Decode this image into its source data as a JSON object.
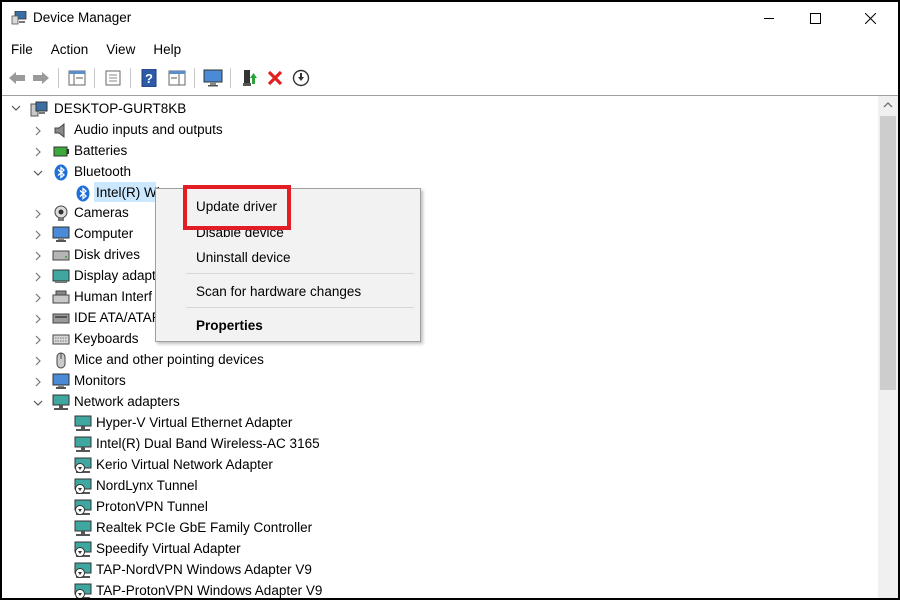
{
  "window": {
    "title": "Device Manager"
  },
  "menu": [
    "File",
    "Action",
    "View",
    "Help"
  ],
  "tree": {
    "root": "DESKTOP-GURT8KB",
    "categories": [
      "Audio inputs and outputs",
      "Batteries",
      "Bluetooth",
      "Intel(R) Wi",
      "Cameras",
      "Computer",
      "Disk drives",
      "Display adapt",
      "Human Interf",
      "IDE ATA/ATAPI",
      "Keyboards",
      "Mice and other pointing devices",
      "Monitors",
      "Network adapters"
    ],
    "network_adapters": [
      "Hyper-V Virtual Ethernet Adapter",
      "Intel(R) Dual Band Wireless-AC 3165",
      "Kerio Virtual Network Adapter",
      "NordLynx Tunnel",
      "ProtonVPN Tunnel",
      "Realtek PCIe GbE Family Controller",
      "Speedify Virtual Adapter",
      "TAP-NordVPN Windows Adapter V9",
      "TAP-ProtonVPN Windows Adapter V9"
    ]
  },
  "context_menu": {
    "update": "Update driver",
    "disable": "Disable device",
    "uninstall": "Uninstall device",
    "scan": "Scan for hardware changes",
    "properties": "Properties"
  },
  "colors": {
    "highlight": "#e31d24",
    "selection": "#cce8ff"
  }
}
